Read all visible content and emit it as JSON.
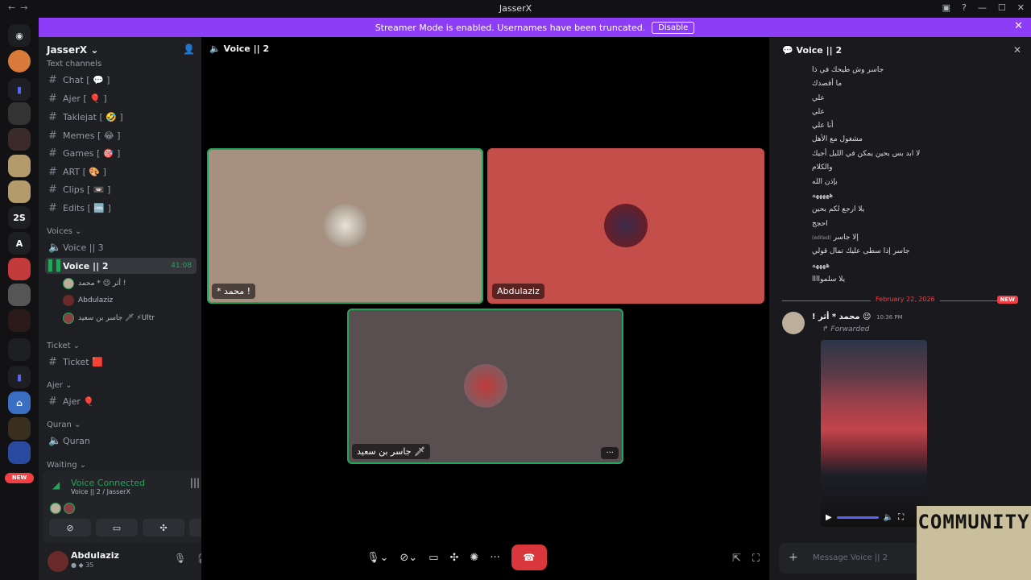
{
  "window": {
    "title": "JasserX"
  },
  "banner": {
    "text": "Streamer Mode is enabled. Usernames have been truncated.",
    "button": "Disable"
  },
  "server_rail": {
    "items": [
      "2S",
      "A"
    ],
    "new_badge": "NEW"
  },
  "server": {
    "name": "JasserX"
  },
  "categories": {
    "text_channels": "Text channels",
    "voices": "Voices",
    "ticket": "Ticket",
    "ajer": "Ajer",
    "quran": "Quran",
    "waiting": "Waiting"
  },
  "text_channels": [
    {
      "name": "Chat [ 💬 ]"
    },
    {
      "name": "Ajer [ 🎈 ]"
    },
    {
      "name": "Taklejat [ 🤣 ]"
    },
    {
      "name": "Memes [ 😂 ]"
    },
    {
      "name": "Games [ 🎯 ]"
    },
    {
      "name": "ART [ 🎨 ]"
    },
    {
      "name": "Clips [ 📼 ]"
    },
    {
      "name": "Edits [ 🆒 ]"
    }
  ],
  "voice_channels": {
    "voice3": "Voice || 3",
    "voice2": "Voice || 2",
    "voice2_time": "41:08",
    "members": [
      "أثر 😉 * محمد !",
      "Abdulaziz",
      "جاسر بن سعيد 🗡 ⚡Ultr"
    ]
  },
  "other_channels": {
    "ticket": "Ticket 🟥",
    "ajer": "Ajer 🎈",
    "quran": "Quran"
  },
  "voice_connected": {
    "status": "Voice Connected",
    "location": "Voice || 2 / JasserX"
  },
  "user": {
    "name": "Abdulaziz",
    "sub": "35"
  },
  "stage": {
    "header": "Voice || 2",
    "tiles": [
      {
        "label": "* محمد !"
      },
      {
        "label": "Abdulaziz"
      },
      {
        "label": "جاسر بن سعيد 🗡",
        "more": "···"
      }
    ]
  },
  "chat": {
    "header": "Voice || 2",
    "messages": [
      "جاسر وش طيحك في ذا",
      "ما أقصدك",
      "علي",
      "علي",
      "أنا علي",
      "مشغول مع الأهل",
      "لا ابد بس بحين يمكن في الليل أجيك",
      "والكلام",
      "بإذن الله",
      "هههههه",
      "يلا ارجع لكم بحين",
      "احجج",
      "إلا جاسر",
      "جاسر إذا سطى عليك تمال قولي",
      "ههههه",
      "يلا سلمواااا"
    ],
    "edited_tag": "(edited)",
    "divider_date": "February 22, 2026",
    "divider_badge": "NEW",
    "author": "! محمد * أثر 😉",
    "timestamp": "10:36 PM",
    "forwarded": "Forwarded",
    "input_placeholder": "Message Voice || 2"
  },
  "watermark": "COMMUNITY"
}
